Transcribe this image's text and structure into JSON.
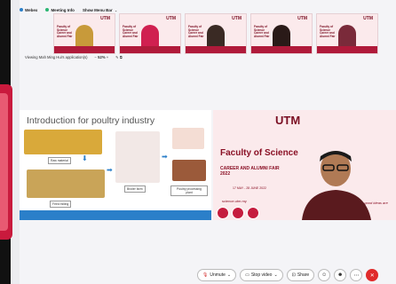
{
  "topbar": {
    "video_label": "Webex",
    "meeting_info_label": "Meeting Info",
    "show_menu_label": "Show Menu Bar"
  },
  "thumbnails": [
    {
      "logo": "UTM",
      "text": "Faculty of Science Career and Alumni Fair"
    },
    {
      "logo": "UTM",
      "text": "Faculty of Science Career and Alumni Fair"
    },
    {
      "logo": "UTM",
      "text": "Faculty of Science Career and Alumni Fair"
    },
    {
      "logo": "UTM",
      "text": "Faculty of Science Career and Alumni Fair"
    },
    {
      "logo": "UTM",
      "text": "Faculty of Science Career and Alumni Fair"
    }
  ],
  "share_bar": {
    "viewing_text": "Viewing Mah Ming Hui's application(s)",
    "zoom": "52%"
  },
  "slide": {
    "title": "Introduction for poultry industry",
    "labels": {
      "raw_material": "Raw material",
      "feed_milling": "Feed milling",
      "broiler_farm": "Broiler farm",
      "processing_plant": "Poultry processing plant"
    }
  },
  "speaker_video": {
    "utm_logo": "UTM",
    "fac_line1": "Faculty of Science",
    "fac_line2": "CAREER AND ALUMNI FAIR",
    "year": "2022",
    "date": "17 MAY - 28 JUNE 2022",
    "url": "science.utm.my",
    "tagline": "...where good ideas are realised"
  },
  "controls": {
    "unmute_label": "Unmute",
    "stop_video_label": "Stop video",
    "share_label": "Share"
  },
  "colors": {
    "accent": "#c51c3e",
    "slide_band": "#2b7fc9",
    "end_button": "#e02b2b"
  }
}
